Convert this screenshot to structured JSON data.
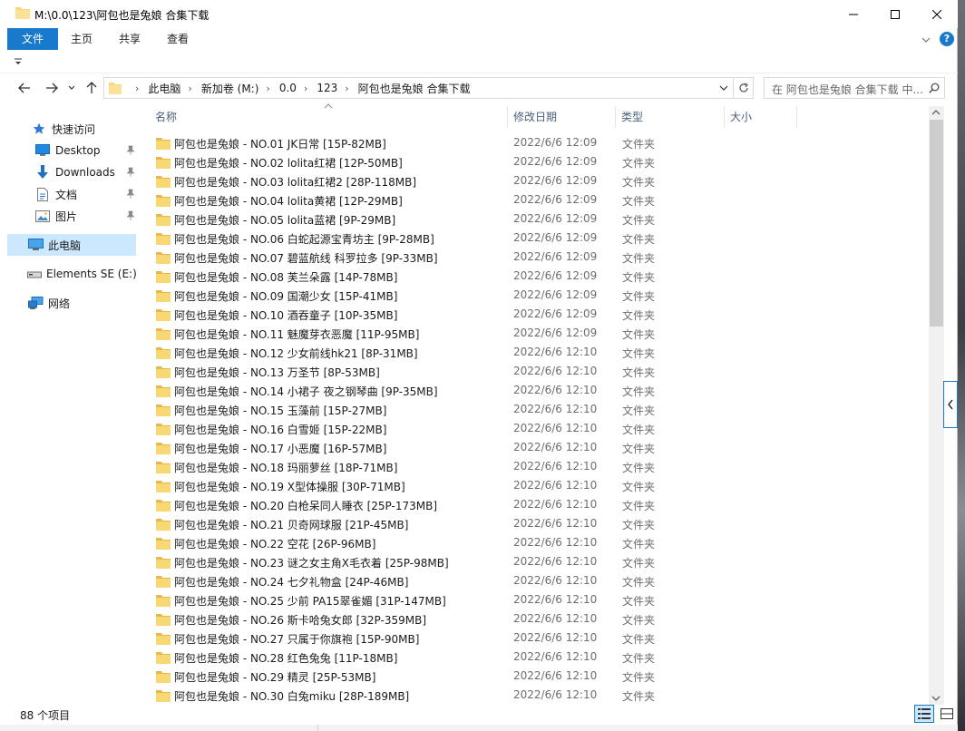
{
  "window": {
    "title": "M:\\0.0\\123\\阿包也是兔娘 合集下载"
  },
  "ribbon": {
    "tabs": [
      "文件",
      "主页",
      "共享",
      "查看"
    ]
  },
  "address": {
    "crumbs": [
      "此电脑",
      "新加卷 (M:)",
      "0.0",
      "123",
      "阿包也是兔娘 合集下载"
    ]
  },
  "search": {
    "placeholder": "在 阿包也是兔娘 合集下载 中..."
  },
  "navpane": {
    "items": [
      {
        "label": "快速访问",
        "icon": "star-icon"
      },
      {
        "label": "Desktop",
        "icon": "desktop-icon"
      },
      {
        "label": "Downloads",
        "icon": "download-icon"
      },
      {
        "label": "文档",
        "icon": "document-icon"
      },
      {
        "label": "图片",
        "icon": "pictures-icon"
      },
      {
        "label": "此电脑",
        "icon": "computer-icon"
      },
      {
        "label": "Elements SE (E:)",
        "icon": "drive-icon"
      },
      {
        "label": "网络",
        "icon": "network-icon"
      }
    ]
  },
  "columns": {
    "name": "名称",
    "date": "修改日期",
    "type": "类型",
    "size": "大小"
  },
  "files": [
    {
      "name": "阿包也是兔娘 - NO.01 JK日常 [15P-82MB]",
      "date": "2022/6/6 12:09",
      "type": "文件夹"
    },
    {
      "name": "阿包也是兔娘 - NO.02 lolita红裙 [12P-50MB]",
      "date": "2022/6/6 12:09",
      "type": "文件夹"
    },
    {
      "name": "阿包也是兔娘 - NO.03 lolita红裙2 [28P-118MB]",
      "date": "2022/6/6 12:09",
      "type": "文件夹"
    },
    {
      "name": "阿包也是兔娘 - NO.04 lolita黄裙 [12P-29MB]",
      "date": "2022/6/6 12:09",
      "type": "文件夹"
    },
    {
      "name": "阿包也是兔娘 - NO.05 lolita蓝裙 [9P-29MB]",
      "date": "2022/6/6 12:09",
      "type": "文件夹"
    },
    {
      "name": "阿包也是兔娘 - NO.06 白蛇起源宝青坊主 [9P-28MB]",
      "date": "2022/6/6 12:09",
      "type": "文件夹"
    },
    {
      "name": "阿包也是兔娘 - NO.07 碧蓝航线 科罗拉多 [9P-33MB]",
      "date": "2022/6/6 12:09",
      "type": "文件夹"
    },
    {
      "name": "阿包也是兔娘 - NO.08 芙兰朵露 [14P-78MB]",
      "date": "2022/6/6 12:09",
      "type": "文件夹"
    },
    {
      "name": "阿包也是兔娘 - NO.09 国潮少女 [15P-41MB]",
      "date": "2022/6/6 12:09",
      "type": "文件夹"
    },
    {
      "name": "阿包也是兔娘 - NO.10 酒吞童子 [10P-35MB]",
      "date": "2022/6/6 12:09",
      "type": "文件夹"
    },
    {
      "name": "阿包也是兔娘 - NO.11 魅魔芽衣恶魔 [11P-95MB]",
      "date": "2022/6/6 12:09",
      "type": "文件夹"
    },
    {
      "name": "阿包也是兔娘 - NO.12 少女前线hk21 [8P-31MB]",
      "date": "2022/6/6 12:10",
      "type": "文件夹"
    },
    {
      "name": "阿包也是兔娘 - NO.13 万圣节 [8P-53MB]",
      "date": "2022/6/6 12:10",
      "type": "文件夹"
    },
    {
      "name": "阿包也是兔娘 - NO.14 小裙子 夜之钢琴曲 [9P-35MB]",
      "date": "2022/6/6 12:10",
      "type": "文件夹"
    },
    {
      "name": "阿包也是兔娘 - NO.15 玉藻前 [15P-27MB]",
      "date": "2022/6/6 12:10",
      "type": "文件夹"
    },
    {
      "name": "阿包也是兔娘 - NO.16 白雪姬 [15P-22MB]",
      "date": "2022/6/6 12:10",
      "type": "文件夹"
    },
    {
      "name": "阿包也是兔娘 - NO.17 小恶魔 [16P-57MB]",
      "date": "2022/6/6 12:10",
      "type": "文件夹"
    },
    {
      "name": "阿包也是兔娘 - NO.18 玛丽萝丝 [18P-71MB]",
      "date": "2022/6/6 12:10",
      "type": "文件夹"
    },
    {
      "name": "阿包也是兔娘 - NO.19 X型体操服 [30P-71MB]",
      "date": "2022/6/6 12:10",
      "type": "文件夹"
    },
    {
      "name": "阿包也是兔娘 - NO.20 白枪呆同人睡衣 [25P-173MB]",
      "date": "2022/6/6 12:10",
      "type": "文件夹"
    },
    {
      "name": "阿包也是兔娘 - NO.21 贝奇网球服 [21P-45MB]",
      "date": "2022/6/6 12:10",
      "type": "文件夹"
    },
    {
      "name": "阿包也是兔娘 - NO.22 空花 [26P-96MB]",
      "date": "2022/6/6 12:10",
      "type": "文件夹"
    },
    {
      "name": "阿包也是兔娘 - NO.23 谜之女主角X毛衣着 [25P-98MB]",
      "date": "2022/6/6 12:10",
      "type": "文件夹"
    },
    {
      "name": "阿包也是兔娘 - NO.24 七夕礼物盒 [24P-46MB]",
      "date": "2022/6/6 12:10",
      "type": "文件夹"
    },
    {
      "name": "阿包也是兔娘 - NO.25 少前 PA15翠雀媚 [31P-147MB]",
      "date": "2022/6/6 12:10",
      "type": "文件夹"
    },
    {
      "name": "阿包也是兔娘 - NO.26 斯卡哈兔女郎 [32P-359MB]",
      "date": "2022/6/6 12:10",
      "type": "文件夹"
    },
    {
      "name": "阿包也是兔娘 - NO.27 只属于你旗袍 [15P-90MB]",
      "date": "2022/6/6 12:10",
      "type": "文件夹"
    },
    {
      "name": "阿包也是兔娘 - NO.28 红色兔兔 [11P-18MB]",
      "date": "2022/6/6 12:10",
      "type": "文件夹"
    },
    {
      "name": "阿包也是兔娘 - NO.29 精灵 [25P-53MB]",
      "date": "2022/6/6 12:10",
      "type": "文件夹"
    },
    {
      "name": "阿包也是兔娘 - NO.30 白兔miku [28P-189MB]",
      "date": "2022/6/6 12:10",
      "type": "文件夹"
    }
  ],
  "status": {
    "count": "88 个项目"
  },
  "colors": {
    "accent": "#1979ca",
    "selected": "#cce8ff",
    "folder": "#f8d775"
  }
}
